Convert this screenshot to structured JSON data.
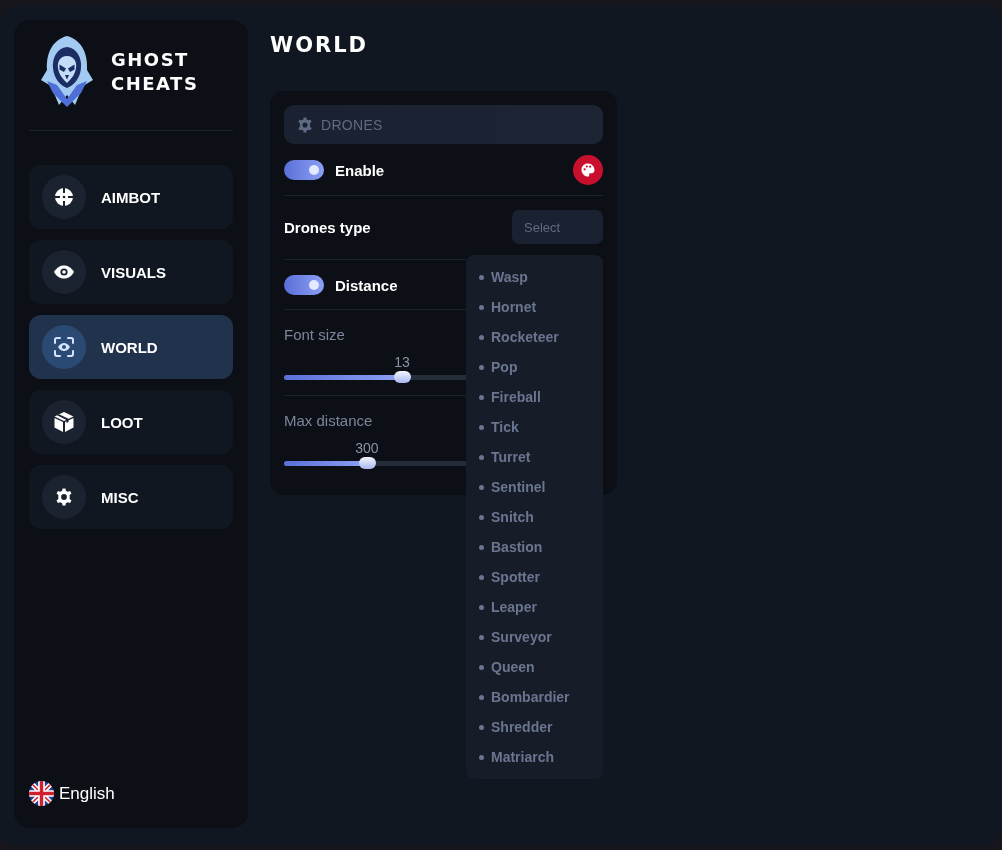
{
  "brand": {
    "name": "GHOST CHEATS"
  },
  "sidebar": {
    "items": [
      {
        "label": "AIMBOT",
        "selected": false
      },
      {
        "label": "VISUALS",
        "selected": false
      },
      {
        "label": "WORLD",
        "selected": true
      },
      {
        "label": "LOOT",
        "selected": false
      },
      {
        "label": "MISC",
        "selected": false
      }
    ]
  },
  "language": {
    "label": "English"
  },
  "page": {
    "title": "WORLD"
  },
  "section": {
    "title": "DRONES",
    "rows": [
      {
        "kind": "toggle",
        "label": "Enable",
        "on": true,
        "color_picker": true
      },
      {
        "kind": "select",
        "label": "Drones type",
        "placeholder": "Select",
        "expanded": true,
        "options": [
          {
            "label": "Wasp",
            "selected": false
          },
          {
            "label": "Hornet",
            "selected": false
          },
          {
            "label": "Rocketeer",
            "selected": false
          },
          {
            "label": "Pop",
            "selected": false
          },
          {
            "label": "Fireball",
            "selected": false
          },
          {
            "label": "Tick",
            "selected": false
          },
          {
            "label": "Turret",
            "selected": false
          },
          {
            "label": "Sentinel",
            "selected": false
          },
          {
            "label": "Snitch",
            "selected": false
          },
          {
            "label": "Bastion",
            "selected": false
          },
          {
            "label": "Spotter",
            "selected": false
          },
          {
            "label": "Leaper",
            "selected": false
          },
          {
            "label": "Surveyor",
            "selected": false
          },
          {
            "label": "Queen",
            "selected": false
          },
          {
            "label": "Bombardier",
            "selected": false
          },
          {
            "label": "Shredder",
            "selected": false
          },
          {
            "label": "Matriarch",
            "selected": false
          }
        ]
      },
      {
        "kind": "toggle",
        "label": "Distance",
        "on": true,
        "color_picker": false
      },
      {
        "kind": "slider",
        "label": "Font size",
        "reading": "13",
        "level": 0.37
      },
      {
        "kind": "slider",
        "label": "Max distance",
        "reading": "300",
        "level": 0.26
      }
    ]
  }
}
